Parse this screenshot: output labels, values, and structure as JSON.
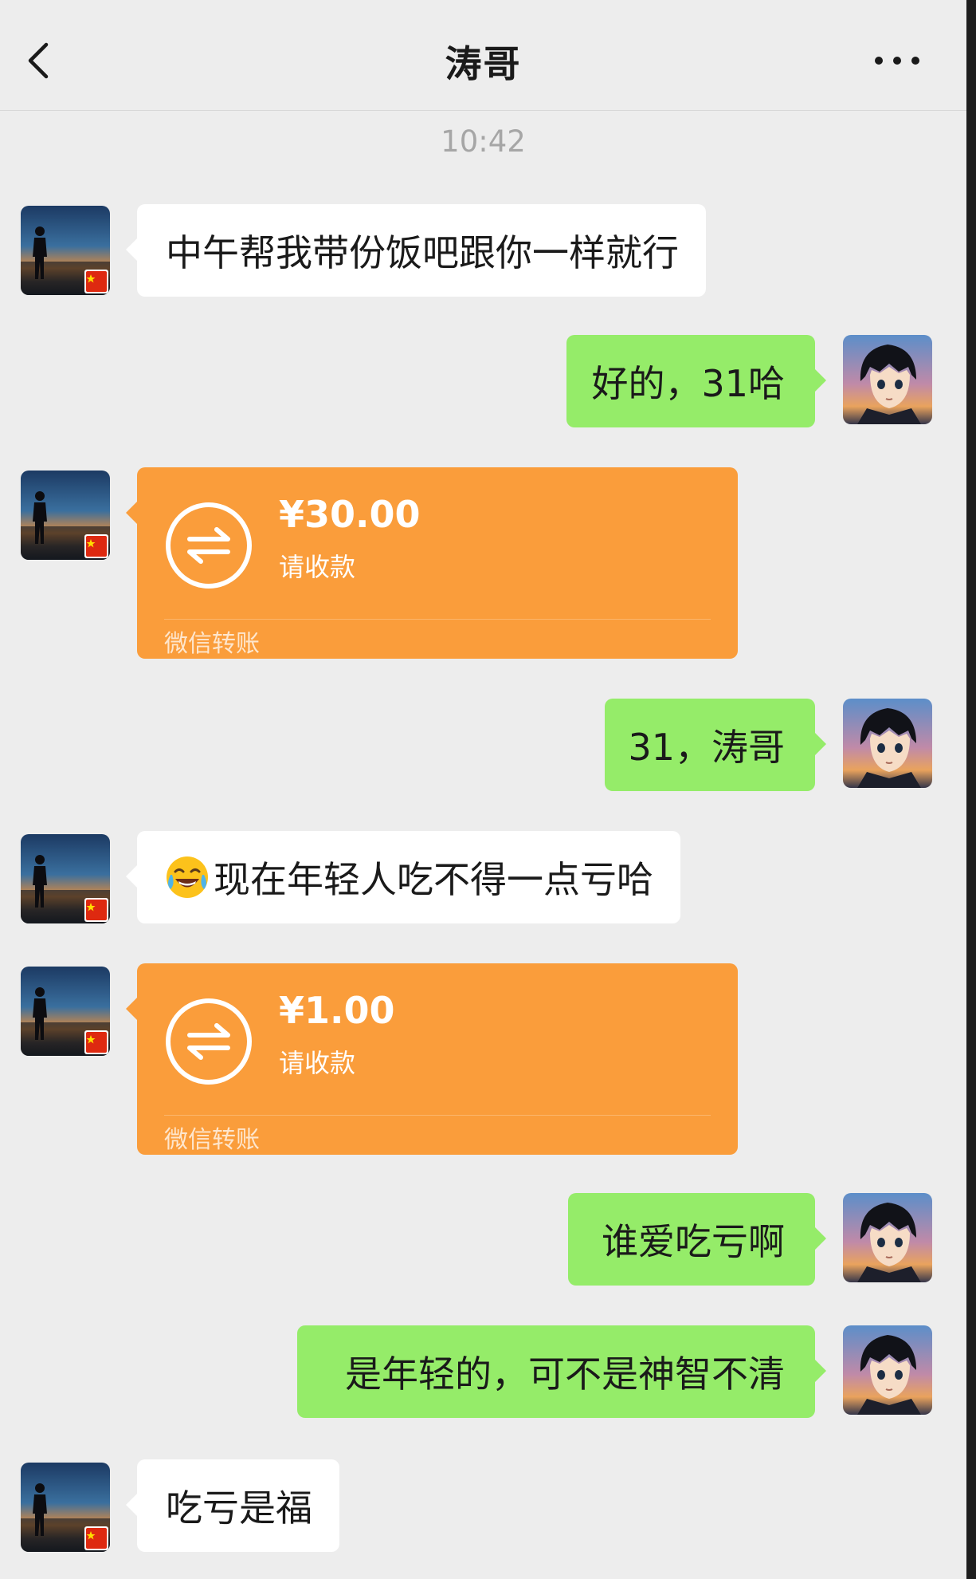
{
  "header": {
    "title": "涛哥",
    "back_icon": "chevron-left-icon",
    "more_icon": "more-dots-icon"
  },
  "timestamp": "10:42",
  "messages": [
    {
      "side": "in",
      "type": "text",
      "text": "中午帮我带份饭吧跟你一样就行"
    },
    {
      "side": "out",
      "type": "text",
      "text": "好的，31哈"
    },
    {
      "side": "in",
      "type": "transfer",
      "amount": "¥30.00",
      "status": "请收款",
      "footer": "微信转账"
    },
    {
      "side": "out",
      "type": "text",
      "text": "31，涛哥"
    },
    {
      "side": "in",
      "type": "text",
      "emoji": "tears-of-joy-emoji",
      "text": "现在年轻人吃不得一点亏哈"
    },
    {
      "side": "in",
      "type": "transfer",
      "amount": "¥1.00",
      "status": "请收款",
      "footer": "微信转账"
    },
    {
      "side": "out",
      "type": "text",
      "text": "谁爱吃亏啊"
    },
    {
      "side": "out",
      "type": "text",
      "text": "是年轻的，可不是神智不清"
    },
    {
      "side": "in",
      "type": "text",
      "text": "吃亏是福"
    }
  ],
  "colors": {
    "background": "#ededed",
    "outgoing_bubble": "#95ec69",
    "incoming_bubble": "#ffffff",
    "transfer_card": "#fa9d3b",
    "timestamp": "#a6a6a6"
  }
}
